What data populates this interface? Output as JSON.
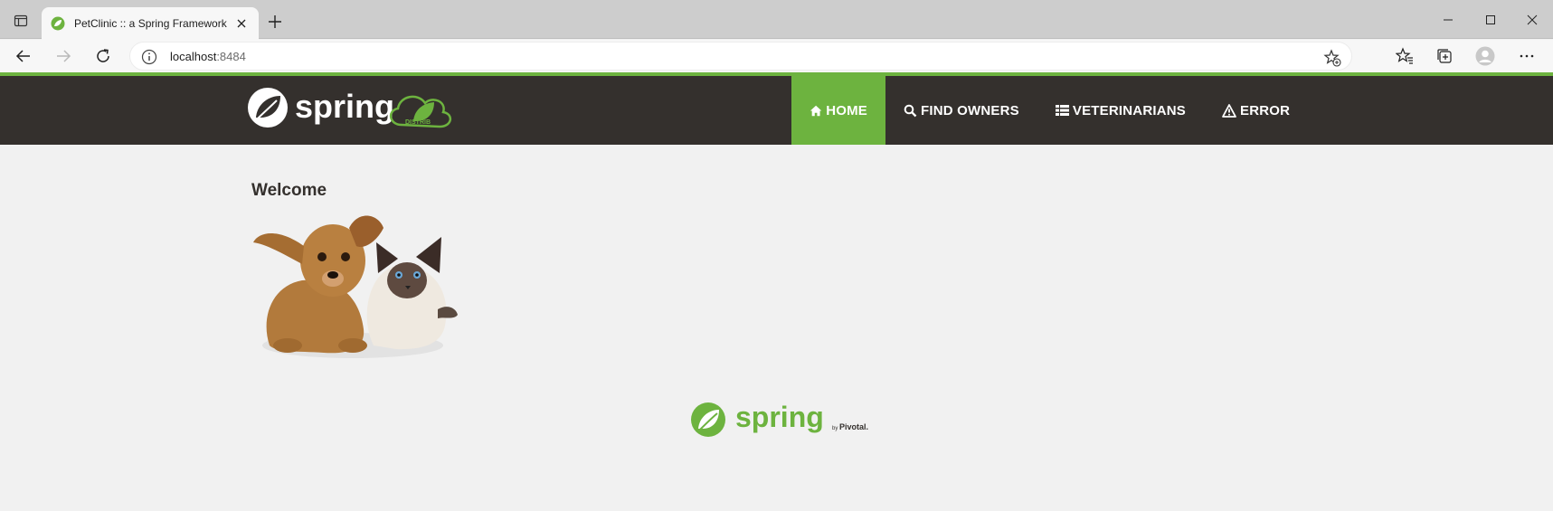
{
  "browser": {
    "tab_title": "PetClinic :: a Spring Framework demonstration",
    "address_host": "localhost",
    "address_port": ":8484"
  },
  "header": {
    "logo_text": "spring",
    "logo_badge": "DISTRIB",
    "nav": [
      {
        "label": "HOME",
        "icon": "home-icon",
        "active": true
      },
      {
        "label": "FIND OWNERS",
        "icon": "search-icon",
        "active": false
      },
      {
        "label": "VETERINARIANS",
        "icon": "list-icon",
        "active": false
      },
      {
        "label": "ERROR",
        "icon": "warning-icon",
        "active": false
      }
    ]
  },
  "main": {
    "heading": "Welcome"
  },
  "footer": {
    "logo_text": "spring",
    "by_text": "by",
    "pivotal_text": "Pivotal."
  },
  "colors": {
    "spring_green": "#6db33f",
    "header_bg": "#34302d",
    "page_bg": "#f1f1f1"
  }
}
